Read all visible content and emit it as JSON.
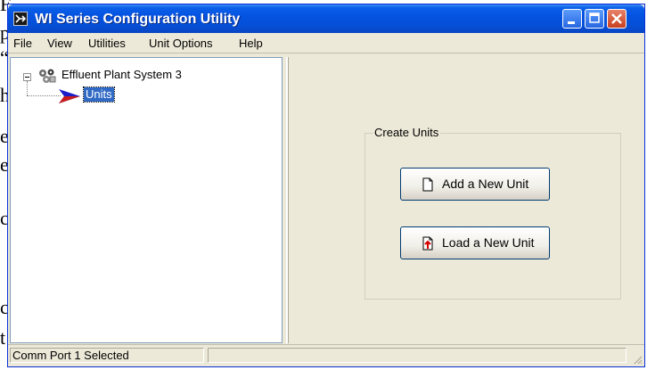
{
  "background_fragments": [
    "F",
    "p",
    "“",
    "h",
    "e",
    "e",
    "c",
    "c",
    "t"
  ],
  "window": {
    "title": "WI Series Configuration Utility",
    "app_icon_glyph": "⨯"
  },
  "menu": {
    "items": [
      "File",
      "View",
      "Utilities",
      "Unit Options",
      "Help"
    ]
  },
  "tree": {
    "root_label": "Effluent Plant System 3",
    "child_label": "Units"
  },
  "panel": {
    "group_title": "Create Units",
    "add_button_label": "Add a New Unit",
    "load_button_label": "Load a New Unit"
  },
  "status": {
    "text": "Comm Port 1 Selected"
  },
  "colors": {
    "title_bar": "#0553e1",
    "selection": "#316ac5",
    "face": "#ece9d8"
  }
}
